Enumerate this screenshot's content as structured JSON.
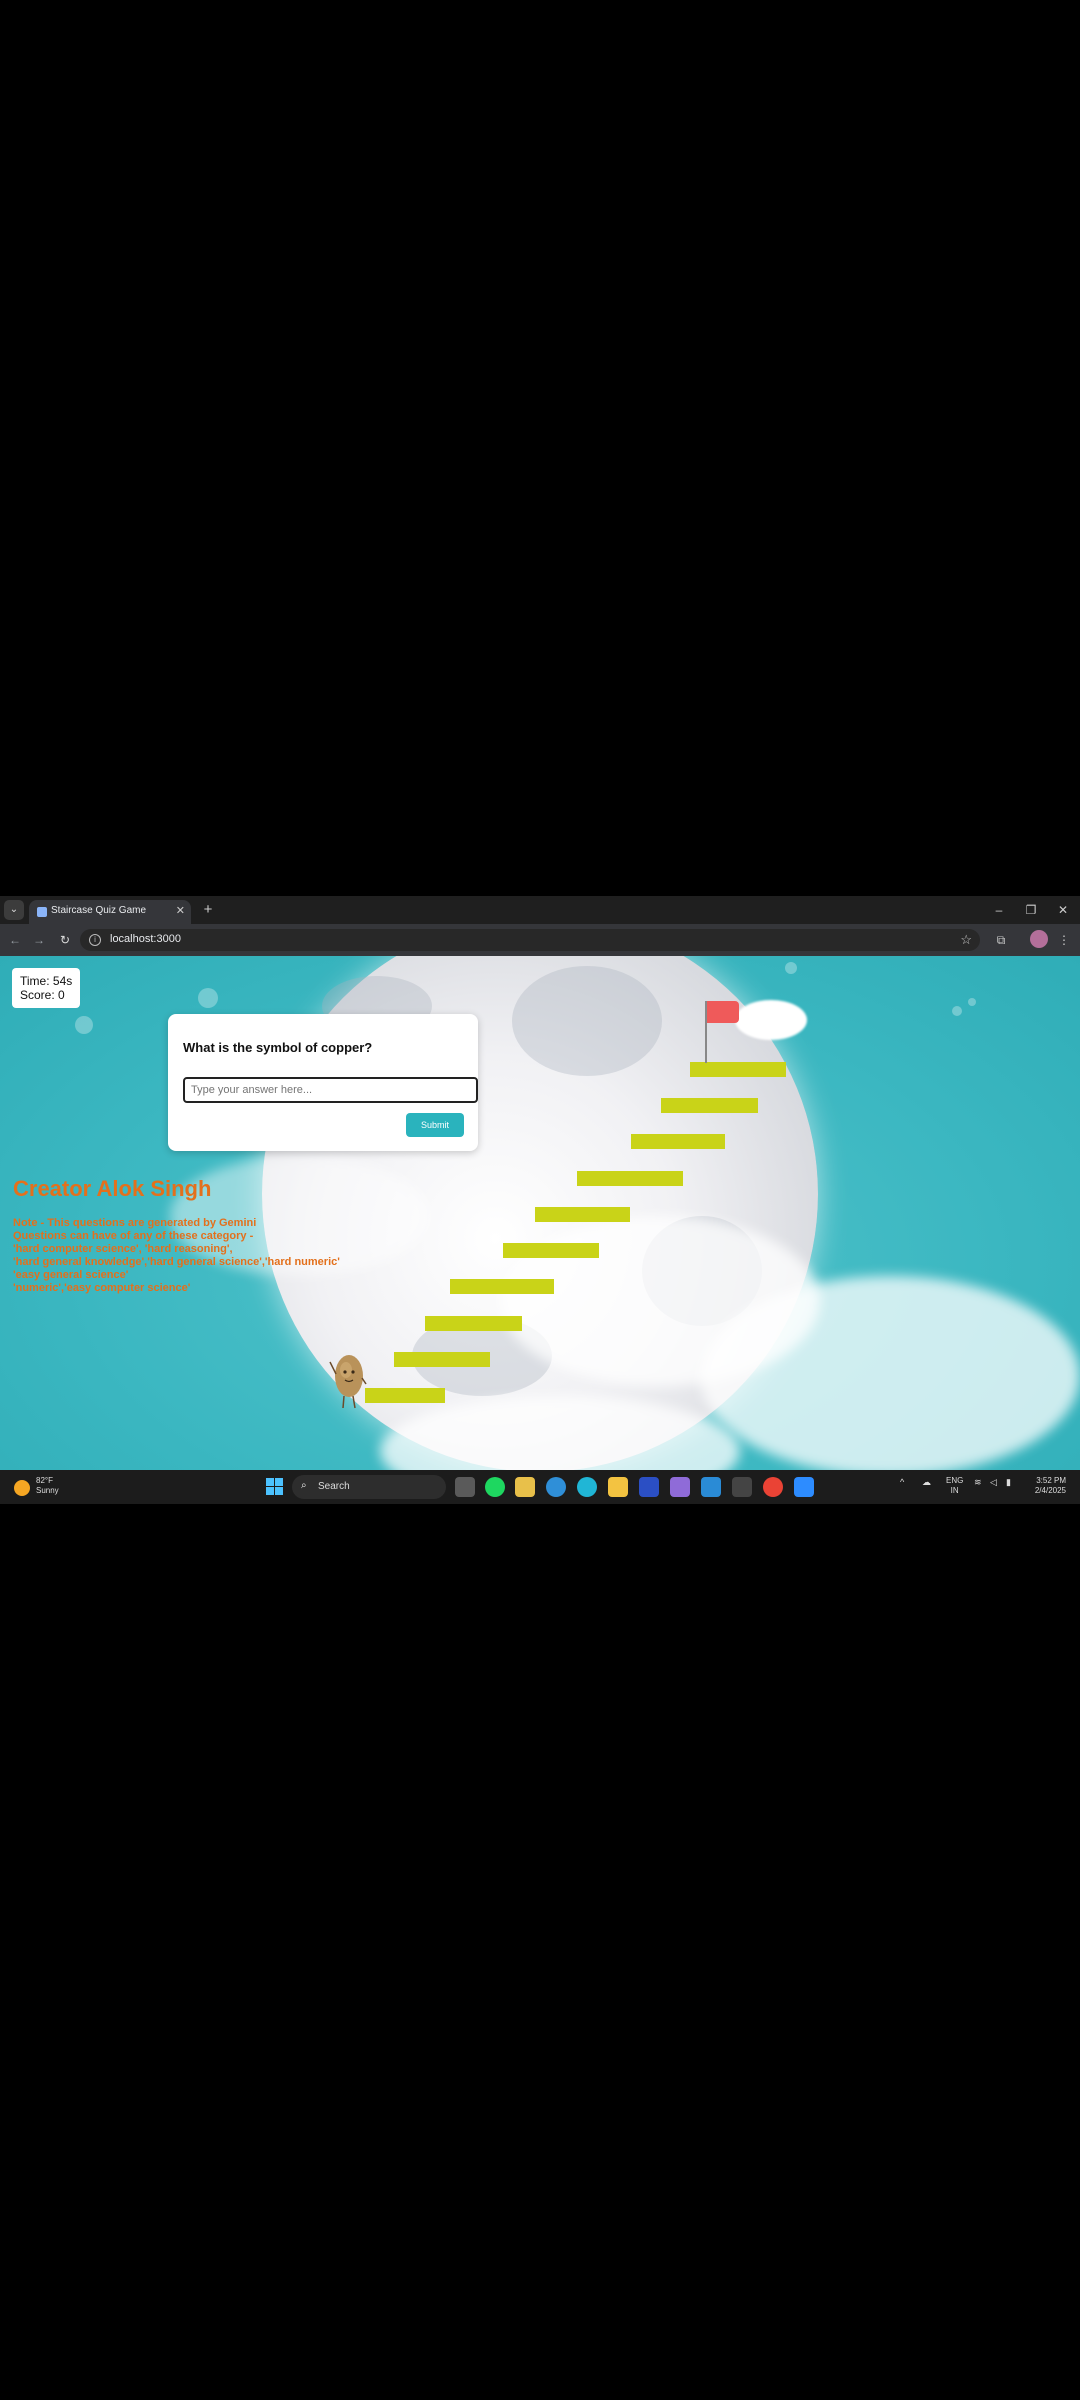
{
  "browser": {
    "tab_title": "Staircase Quiz Game",
    "tab_close": "✕",
    "new_tab": "+",
    "url": "localhost:3000",
    "window_controls": [
      "–",
      "❐",
      "✕"
    ]
  },
  "game": {
    "time_label": "Time: 54s",
    "score_label": "Score: 0",
    "question": "What is the symbol of copper?",
    "answer_placeholder": "Type your answer here...",
    "submit_label": "Submit",
    "creator": "Creator Alok Singh",
    "notes": [
      "Note - This questions are generated by Gemini",
      "Questions can have of any of these category -",
      "'hard computer science', 'hard reasoning',",
      "'hard general knowledge','hard general science','hard numeric'",
      "'easy general science'",
      "'numeric','easy computer science'"
    ]
  },
  "taskbar": {
    "weather_temp": "82°F",
    "weather_cond": "Sunny",
    "search_label": "Search",
    "lang_top": "ENG",
    "lang_bottom": "IN",
    "time": "3:52 PM",
    "date": "2/4/2025"
  },
  "colors": {
    "step": "#c9d318",
    "sky": "#3bb7c1",
    "accent_text": "#e3701c",
    "submit": "#2ab3bd"
  }
}
